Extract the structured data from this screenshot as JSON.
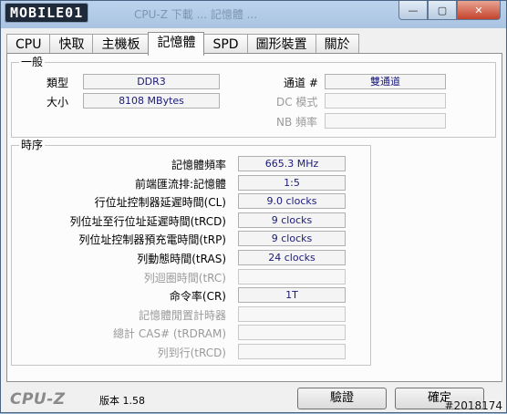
{
  "titlebar": {
    "logo": "MOBILE01",
    "faded_title": "CPU-Z 下載 ... 記憶體 ..."
  },
  "window_buttons": {
    "minimize": "—",
    "maximize": "▢",
    "close": "✕"
  },
  "tabs": [
    {
      "label": "CPU"
    },
    {
      "label": "快取"
    },
    {
      "label": "主機板"
    },
    {
      "label": "記憶體"
    },
    {
      "label": "SPD"
    },
    {
      "label": "圖形裝置"
    },
    {
      "label": "關於"
    }
  ],
  "general": {
    "title": "一般",
    "type_label": "類型",
    "type_value": "DDR3",
    "size_label": "大小",
    "size_value": "8108 MBytes",
    "channel_label": "通道 #",
    "channel_value": "雙通道",
    "dc_label": "DC 模式",
    "dc_value": "",
    "nb_label": "NB 頻率",
    "nb_value": ""
  },
  "timings": {
    "title": "時序",
    "rows": [
      {
        "label": "記憶體頻率",
        "value": "665.3 MHz"
      },
      {
        "label": "前端匯流排:記憶體",
        "value": "1:5"
      },
      {
        "label": "行位址控制器延遲時間(CL)",
        "value": "9.0 clocks"
      },
      {
        "label": "列位址至行位址延遲時間(tRCD)",
        "value": "9 clocks"
      },
      {
        "label": "列位址控制器預充電時間(tRP)",
        "value": "9 clocks"
      },
      {
        "label": "列動態時間(tRAS)",
        "value": "24 clocks"
      },
      {
        "label": "列迴圈時間(tRC)",
        "value": ""
      },
      {
        "label": "命令率(CR)",
        "value": "1T"
      },
      {
        "label": "記憶體閒置計時器",
        "value": ""
      },
      {
        "label": "總計 CAS# (tRDRAM)",
        "value": ""
      },
      {
        "label": "列到行(tRCD)",
        "value": ""
      }
    ]
  },
  "footer": {
    "brand": "CPU-Z",
    "version": "版本 1.58",
    "validate_label": "驗證",
    "ok_label": "確定",
    "watermark": "#2018174"
  }
}
